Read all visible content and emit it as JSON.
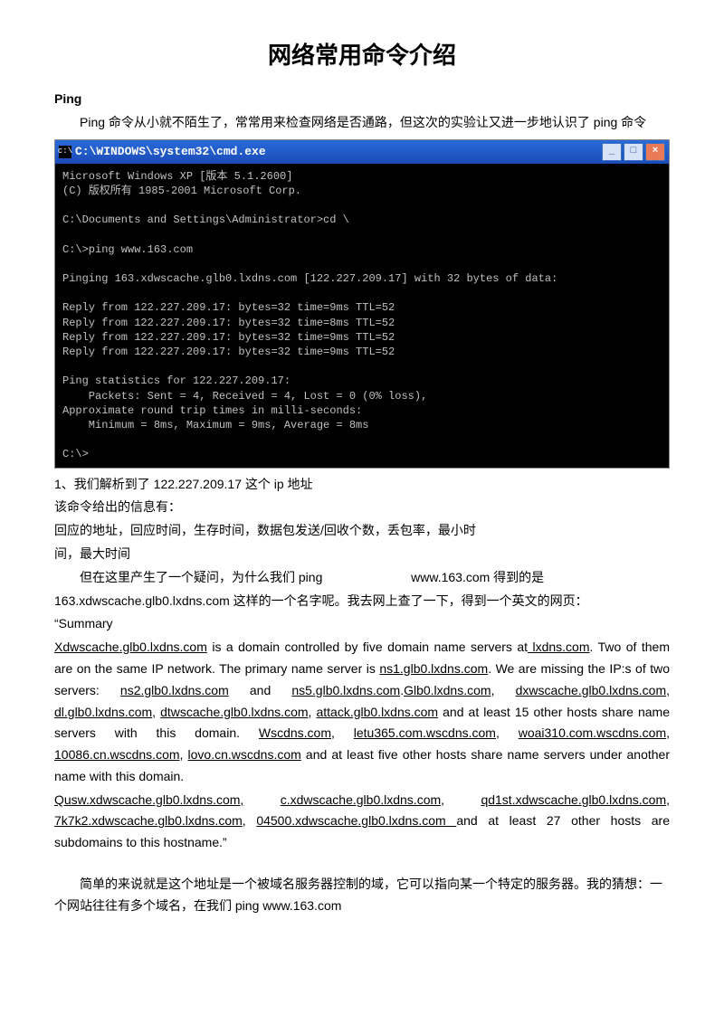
{
  "title": "网络常用命令介绍",
  "heading_ping": "Ping",
  "intro": "Ping 命令从小就不陌生了，常常用来检查网络是否通路，但这次的实验让又进一步地认识了 ping 命令",
  "cmd": {
    "titlebar": "C:\\WINDOWS\\system32\\cmd.exe",
    "min": "_",
    "max": "□",
    "close": "×",
    "body": "Microsoft Windows XP [版本 5.1.2600]\n(C) 版权所有 1985-2001 Microsoft Corp.\n\nC:\\Documents and Settings\\Administrator>cd \\\n\nC:\\>ping www.163.com\n\nPinging 163.xdwscache.glb0.lxdns.com [122.227.209.17] with 32 bytes of data:\n\nReply from 122.227.209.17: bytes=32 time=9ms TTL=52\nReply from 122.227.209.17: bytes=32 time=8ms TTL=52\nReply from 122.227.209.17: bytes=32 time=9ms TTL=52\nReply from 122.227.209.17: bytes=32 time=9ms TTL=52\n\nPing statistics for 122.227.209.17:\n    Packets: Sent = 4, Received = 4, Lost = 0 (0% loss),\nApproximate round trip times in milli-seconds:\n    Minimum = 8ms, Maximum = 9ms, Average = 8ms\n\nC:\\>"
  },
  "l1": "1、我们解析到了 122.227.209.17 这个 ip 地址",
  "l2": "该命令给出的信息有：",
  "l3": "回应的地址，回应时间，生存时间，数据包发送/回收个数，丢包率，最小时",
  "l4": "间，最大时间",
  "l5a": "但在这里产生了一个疑问，为什么我们 ping",
  "l5b": "www.163.com 得到的是",
  "l6": "163.xdwscache.glb0.lxdns.com 这样的一个名字呢。我去网上查了一下，得到一个英文的网页：",
  "summary_label": "“Summary",
  "s1_a": "Xdwscache.glb0.lxdns.com",
  "s1_b": " is a domain controlled by five domain name servers at",
  "s1_c": " lxdns.com",
  "s1_d": ". Two of them are on the same IP network. The primary name server is ",
  "s1_e": "ns1.glb0.lxdns.com",
  "s1_f": ". We are missing the IP:s of two servers: ",
  "s1_g": "ns2.glb0.lxdns.com",
  "s1_h": " and ",
  "s1_i": "ns5.glb0.lxdns.com",
  "s1_j": ".",
  "s1_k": "Glb0.lxdns.com",
  "s1_l": ", ",
  "s1_m": "dxwscache.glb0.lxdns.com",
  "s1_n": ", ",
  "s1_o": "dl.glb0.lxdns.com",
  "s1_p": ", ",
  "s1_q": "dtwscache.glb0.lxdns.com",
  "s1_r": ", ",
  "s1_s": "attack.glb0.lxdns.com",
  "s1_t": " and at least 15 other hosts share name servers with this domain. ",
  "s1_u": "Wscdns.com",
  "s1_v": ", ",
  "s1_w": "letu365.com.wscdns.com",
  "s1_x": ", ",
  "s1_y": "woai310.com.wscdns.com",
  "s1_z": ", ",
  "s1_za": "10086.cn.wscdns.com",
  "s1_zb": ", ",
  "s1_zc": "lovo.cn.wscdns.com",
  "s1_zd": " and at least five other hosts share name servers under another name with this domain.",
  "s2_a": "Qusw.xdwscache.glb0.lxdns.com,",
  "s2_b": " ",
  "s2_c": "c.xdwscache.glb0.lxdns.com",
  "s2_d": ", ",
  "s2_e": "qd1st.xdwscache.glb0.lxdns.com",
  "s2_f": ", ",
  "s2_g": "7k7k2.xdwscache.glb0.lxdns.com",
  "s2_h": ", ",
  "s2_i": "04500.xdwscache.glb0.lxdns.com ",
  "s2_j": "and at least 27 other hosts are subdomains to this hostname.”",
  "tail": "简单的来说就是这个地址是一个被域名服务器控制的域，它可以指向某一个特定的服务器。我的猜想：一个网站往往有多个域名，在我们 ping www.163.com"
}
